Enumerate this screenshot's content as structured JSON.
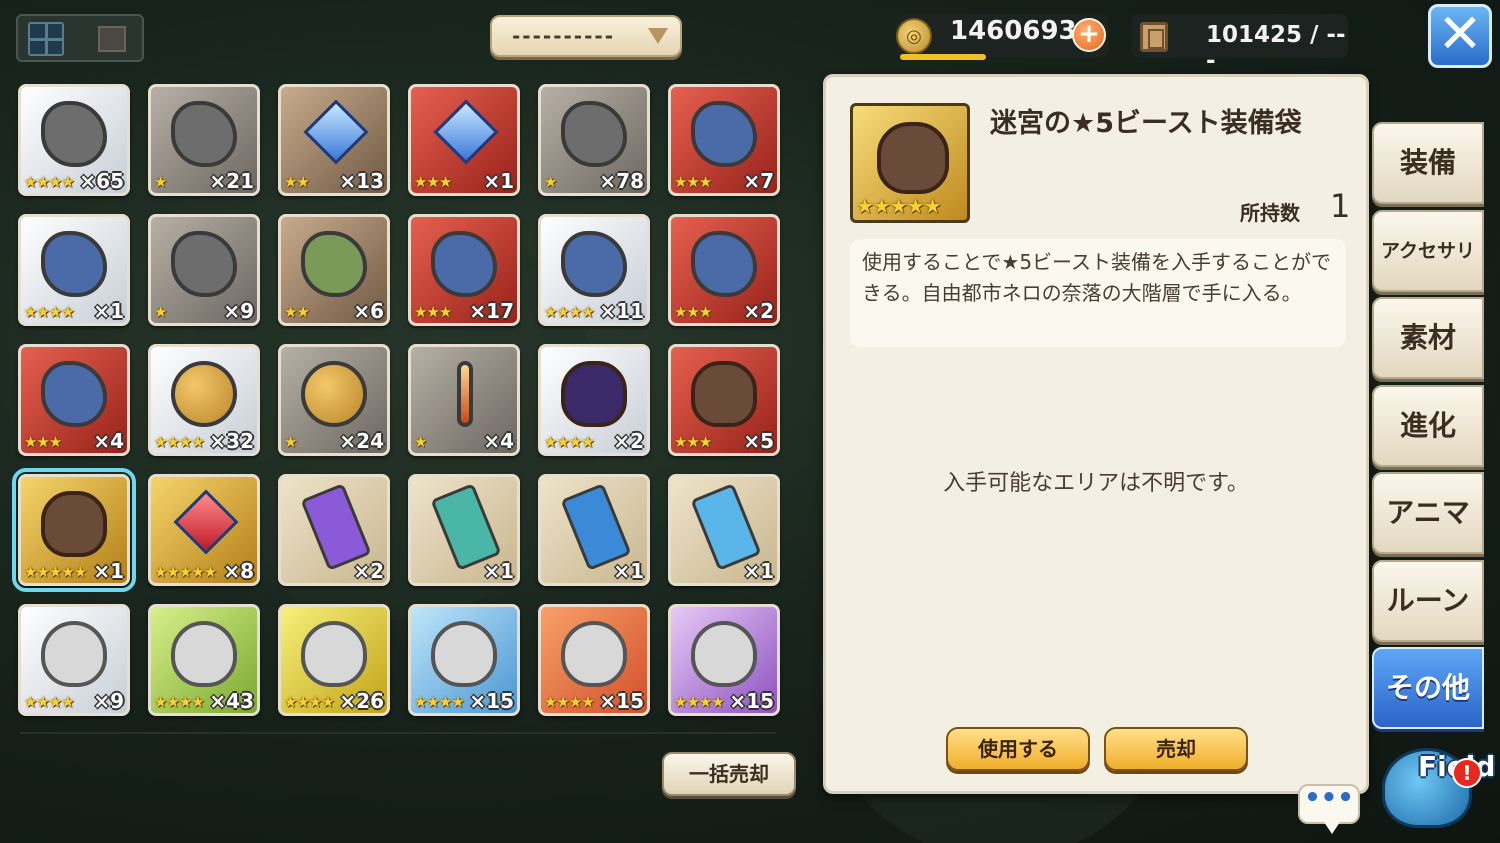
{
  "view_toggle": {
    "grid_icon": "grid-icon",
    "list_icon": "list-icon"
  },
  "sort": {
    "label": "----------"
  },
  "currency": {
    "gold": "1460693",
    "gold_plus": "+",
    "storage": "101425 / ---"
  },
  "close": {
    "label": "✕"
  },
  "items": [
    {
      "stars": "★★★★",
      "count": "×65",
      "bg": "bg-white",
      "art": "crown-icon"
    },
    {
      "stars": "★",
      "count": "×21",
      "bg": "bg-gray",
      "art": "hat-icon"
    },
    {
      "stars": "★★",
      "count": "×13",
      "bg": "bg-bronze",
      "art": "crystal-icon"
    },
    {
      "stars": "★★★",
      "count": "×1",
      "bg": "bg-red",
      "art": "crystal-icon"
    },
    {
      "stars": "★",
      "count": "×78",
      "bg": "bg-gray",
      "art": "rune-stone-icon"
    },
    {
      "stars": "★★★",
      "count": "×7",
      "bg": "bg-red",
      "art": "rune-stone-icon"
    },
    {
      "stars": "★★★★",
      "count": "×1",
      "bg": "bg-white",
      "art": "rune-stone-icon"
    },
    {
      "stars": "★",
      "count": "×9",
      "bg": "bg-gray",
      "art": "rune-stone-icon"
    },
    {
      "stars": "★★",
      "count": "×6",
      "bg": "bg-bronze",
      "art": "rune-stone-icon"
    },
    {
      "stars": "★★★",
      "count": "×17",
      "bg": "bg-red",
      "art": "rune-stone-icon"
    },
    {
      "stars": "★★★★",
      "count": "×11",
      "bg": "bg-white",
      "art": "rune-stone-icon"
    },
    {
      "stars": "★★★",
      "count": "×2",
      "bg": "bg-red",
      "art": "rune-stone-icon"
    },
    {
      "stars": "★★★",
      "count": "×4",
      "bg": "bg-red",
      "art": "rune-stone-icon"
    },
    {
      "stars": "★★★★",
      "count": "×32",
      "bg": "bg-white",
      "art": "fruit-icon"
    },
    {
      "stars": "★",
      "count": "×24",
      "bg": "bg-gray",
      "art": "fruit-icon"
    },
    {
      "stars": "★",
      "count": "×4",
      "bg": "bg-gray",
      "art": "vial-icon"
    },
    {
      "stars": "★★★★",
      "count": "×2",
      "bg": "bg-white",
      "art": "bag-icon"
    },
    {
      "stars": "★★★",
      "count": "×5",
      "bg": "bg-red",
      "art": "bag-icon"
    },
    {
      "stars": "★★★★★",
      "count": "×1",
      "bg": "bg-gold",
      "art": "bag-icon",
      "selected": true
    },
    {
      "stars": "★★★★★",
      "count": "×8",
      "bg": "bg-gold",
      "art": "crystal-icon"
    },
    {
      "stars": "",
      "count": "×2",
      "bg": "bg-cream",
      "art": "ticket-icon"
    },
    {
      "stars": "",
      "count": "×1",
      "bg": "bg-cream",
      "art": "ticket-icon"
    },
    {
      "stars": "",
      "count": "×1",
      "bg": "bg-cream",
      "art": "ticket-icon"
    },
    {
      "stars": "",
      "count": "×1",
      "bg": "bg-cream",
      "art": "ticket-icon"
    },
    {
      "stars": "★★★★",
      "count": "×9",
      "bg": "bg-white",
      "art": "head-icon"
    },
    {
      "stars": "★★★★",
      "count": "×43",
      "bg": "bg-green",
      "art": "head-icon"
    },
    {
      "stars": "★★★★",
      "count": "×26",
      "bg": "bg-yellow",
      "art": "head-icon"
    },
    {
      "stars": "★★★★",
      "count": "×15",
      "bg": "bg-blue",
      "art": "head-icon"
    },
    {
      "stars": "★★★★",
      "count": "×15",
      "bg": "bg-orange",
      "art": "head-icon"
    },
    {
      "stars": "★★★★",
      "count": "×15",
      "bg": "bg-purple",
      "art": "head-icon"
    }
  ],
  "bulk_sell": "一括売却",
  "detail": {
    "title": "迷宮の★5ビースト装備袋",
    "stars": "★★★★★",
    "own_label": "所持数",
    "own_value": "1",
    "description": "使用することで★5ビースト装備を入手することができる。自由都市ネロの奈落の大階層で手に入る。",
    "area_note": "入手可能なエリアは不明です。",
    "use_button": "使用する",
    "sell_button": "売却"
  },
  "tabs": [
    "装備",
    "アクセサリ",
    "素材",
    "進化",
    "アニマ",
    "ルーン",
    "その他"
  ],
  "active_tab": "その他",
  "field": {
    "label": "Field",
    "alert": "!"
  },
  "chat": {
    "label": "•••"
  }
}
